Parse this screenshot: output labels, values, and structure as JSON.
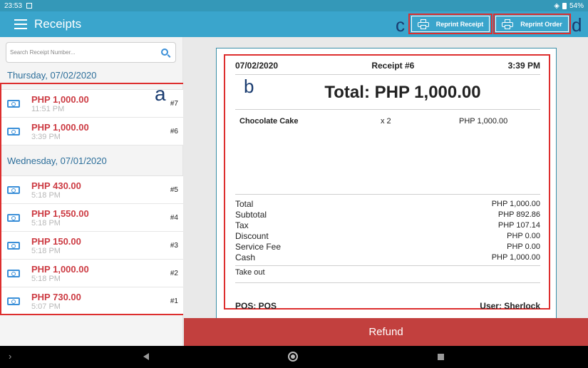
{
  "status_bar": {
    "time": "23:53",
    "battery": "54%"
  },
  "app_bar": {
    "title": "Receipts",
    "reprint_receipt_label": "Reprint Receipt",
    "reprint_order_label": "Reprint Order"
  },
  "annotations": {
    "a": "a",
    "b": "b",
    "c": "c",
    "d": "d"
  },
  "search": {
    "placeholder": "Search Receipt Number..."
  },
  "groups": [
    {
      "date": "Thursday, 07/02/2020",
      "receipts": [
        {
          "amount": "PHP 1,000.00",
          "time": "11:51 PM",
          "number": "#7"
        },
        {
          "amount": "PHP 1,000.00",
          "time": "3:39 PM",
          "number": "#6"
        }
      ]
    },
    {
      "date": "Wednesday, 07/01/2020",
      "receipts": [
        {
          "amount": "PHP 430.00",
          "time": "5:18 PM",
          "number": "#5"
        },
        {
          "amount": "PHP 1,550.00",
          "time": "5:18 PM",
          "number": "#4"
        },
        {
          "amount": "PHP 150.00",
          "time": "5:18 PM",
          "number": "#3"
        },
        {
          "amount": "PHP 1,000.00",
          "time": "5:18 PM",
          "number": "#2"
        },
        {
          "amount": "PHP 730.00",
          "time": "5:07 PM",
          "number": "#1"
        }
      ]
    }
  ],
  "receipt": {
    "date": "07/02/2020",
    "title": "Receipt #6",
    "time": "3:39 PM",
    "total": "Total: PHP 1,000.00",
    "items": [
      {
        "name": "Chocolate Cake",
        "qty": "x 2",
        "price": "PHP 1,000.00"
      }
    ],
    "summary": [
      {
        "label": "Total",
        "value": "PHP 1,000.00"
      },
      {
        "label": "Subtotal",
        "value": "PHP 892.86"
      },
      {
        "label": "Tax",
        "value": "PHP 107.14"
      },
      {
        "label": "Discount",
        "value": "PHP 0.00"
      },
      {
        "label": "Service Fee",
        "value": "PHP 0.00"
      },
      {
        "label": "Cash",
        "value": "PHP 1,000.00"
      }
    ],
    "order_type": "Take out",
    "pos": "POS: POS",
    "user": "User: Sherlock"
  },
  "refund_label": "Refund",
  "colors": {
    "primary": "#3aa5cc",
    "accent_red": "#cc3a42",
    "refund": "#c2403e",
    "annotation_box": "#dd2e2e"
  }
}
